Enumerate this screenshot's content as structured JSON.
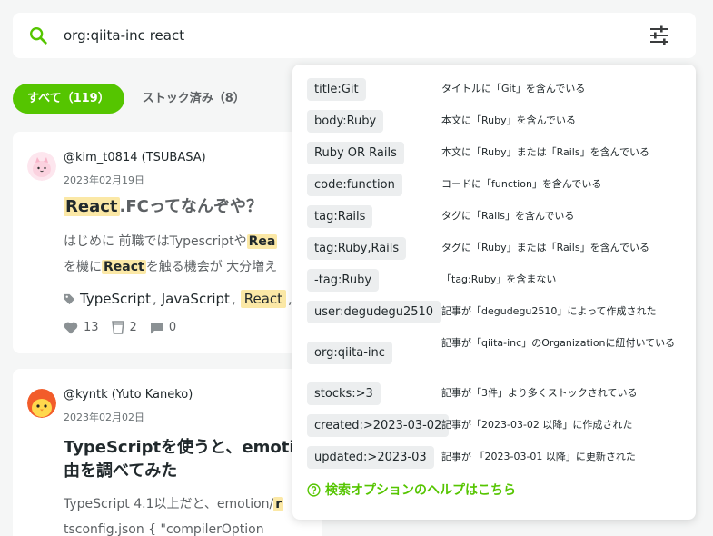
{
  "search": {
    "query": "org:qiita-inc react",
    "icon": "search-icon",
    "filter_icon": "sliders-icon"
  },
  "tabs": [
    {
      "label": "すべて（119）",
      "active": true
    },
    {
      "label": "ストック済み（8）",
      "active": false
    }
  ],
  "articles": [
    {
      "user": "@kim_t0814 (TSUBASA)",
      "date": "2023年02月19日",
      "title_hl": "React",
      "title_rest": ".FCってなんぞや？",
      "excerpt1_pre": "はじめに 前職ではTypescriptや",
      "excerpt1_hl": "Rea",
      "excerpt2_pre": "を機に",
      "excerpt2_hl": "React",
      "excerpt2_post": "を触る機会が 大分増え",
      "tags": [
        "TypeScript",
        "JavaScript",
        "React"
      ],
      "likes": "13",
      "stocks": "2",
      "comments": "0"
    },
    {
      "user": "@kyntk (Yuto Kaneko)",
      "date": "2023年02月02日",
      "title_line1": "TypeScriptを使うと、emoti",
      "title_line2": "由を調べてみた",
      "excerpt1_pre": "TypeScript 4.1以上だと、emotion/",
      "excerpt1_hl": "r",
      "excerpt2": "tsconfig.json { \"compilerOption"
    }
  ],
  "help": {
    "options": [
      {
        "query": "title:Git",
        "desc": "タイトルに「Git」を含んでいる"
      },
      {
        "query": "body:Ruby",
        "desc": "本文に「Ruby」を含んでいる"
      },
      {
        "query": "Ruby OR Rails",
        "desc": "本文に「Ruby」または「Rails」を含んでいる"
      },
      {
        "query": "code:function",
        "desc": "コードに「function」を含んでいる"
      },
      {
        "query": "tag:Rails",
        "desc": "タグに「Rails」を含んでいる"
      },
      {
        "query": "tag:Ruby,Rails",
        "desc": "タグに「Ruby」または「Rails」を含んでいる"
      },
      {
        "query": "-tag:Ruby",
        "desc": "「tag:Ruby」を含まない"
      },
      {
        "query": "user:degudegu2510",
        "desc": "記事が「degudegu2510」によって作成された"
      },
      {
        "query": "org:qiita-inc",
        "desc": "記事が「qiita-inc」のOrganizationに紐付いている"
      },
      {
        "query": "stocks:>3",
        "desc": "記事が「3件」より多くストックされている"
      },
      {
        "query": "created:>2023-03-02",
        "desc": "記事が「2023-03-02 以降」に作成された"
      },
      {
        "query": "updated:>2023-03",
        "desc": "記事が 「2023-03-01 以降」に更新された"
      }
    ],
    "link": "検索オプションのヘルプはこちら"
  },
  "colors": {
    "accent": "#55c500",
    "highlight": "#fbe8a6",
    "background": "#f5f6f6"
  }
}
